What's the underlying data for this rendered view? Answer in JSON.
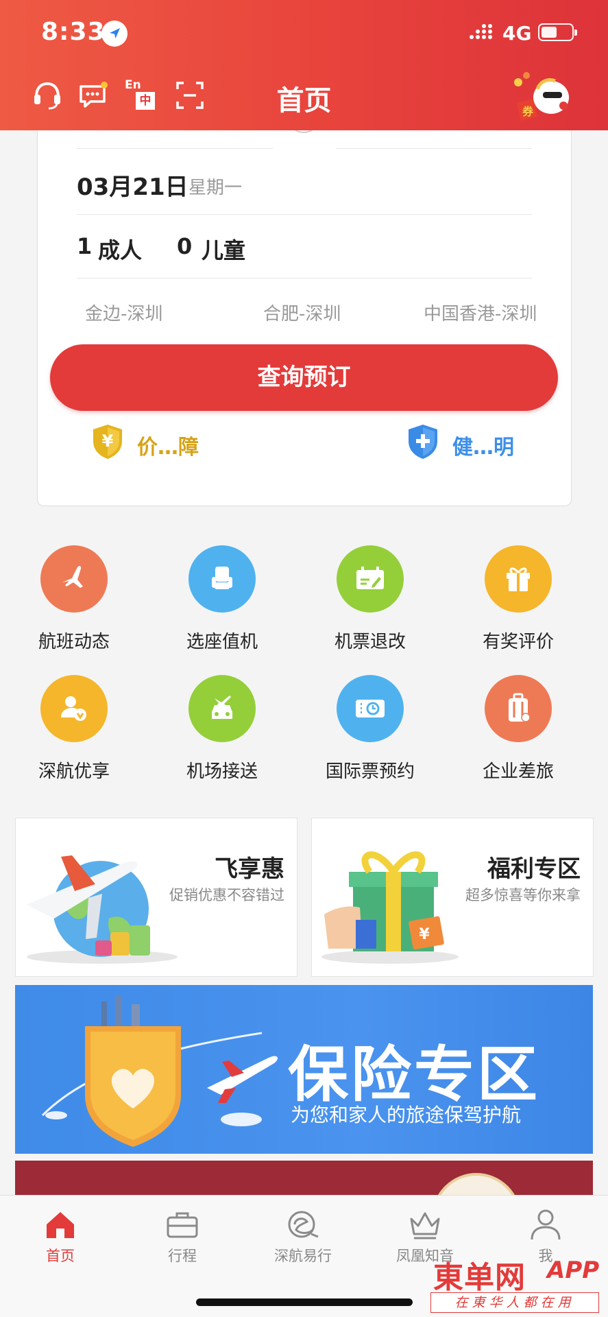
{
  "status_bar": {
    "time": "8:33",
    "network": "4G"
  },
  "header": {
    "title": "首页",
    "lang_toggle_en": "En",
    "lang_toggle_zh": "中",
    "mascot_badge": "券"
  },
  "search": {
    "date": "03月21日",
    "weekday": "星期一",
    "adults_count": "1",
    "adults_label": "成人",
    "children_count": "0",
    "children_label": "儿童",
    "recent_routes": [
      "金边-深圳",
      "合肥-深圳",
      "中国香港-深圳"
    ],
    "query_button": "查询预订",
    "price_guarantee": "价…障",
    "health_notice": "健…明"
  },
  "services": [
    {
      "label": "航班动态",
      "icon": "plane-icon",
      "color": "#ee7a55"
    },
    {
      "label": "选座值机",
      "icon": "seat-icon",
      "color": "#4fb2ef"
    },
    {
      "label": "机票退改",
      "icon": "ticket-edit-icon",
      "color": "#94cf3a"
    },
    {
      "label": "有奖评价",
      "icon": "gift-icon",
      "color": "#f5b62b"
    },
    {
      "label": "深航优享",
      "icon": "vip-user-icon",
      "color": "#f5b62b"
    },
    {
      "label": "机场接送",
      "icon": "car-icon",
      "color": "#94cf3a"
    },
    {
      "label": "国际票预约",
      "icon": "clock-ticket-icon",
      "color": "#4fb2ef"
    },
    {
      "label": "企业差旅",
      "icon": "luggage-icon",
      "color": "#ee7a55"
    }
  ],
  "promos": {
    "left": {
      "title": "飞享惠",
      "subtitle": "促销优惠不容错过"
    },
    "right": {
      "title": "福利专区",
      "subtitle": "超多惊喜等你来拿"
    }
  },
  "insurance_banner": {
    "title": "保险专区",
    "subtitle": "为您和家人的旅途保驾护航"
  },
  "tabbar": {
    "items": [
      "首页",
      "行程",
      "深航易行",
      "凤凰知音",
      "我"
    ],
    "active": "首页"
  },
  "watermark": {
    "brand": "東单网",
    "app": "APP",
    "slogan": "在東华人都在用"
  },
  "colors": {
    "brand_red": "#e23b3a",
    "gold": "#d6a317",
    "blue": "#3d8fe8"
  }
}
